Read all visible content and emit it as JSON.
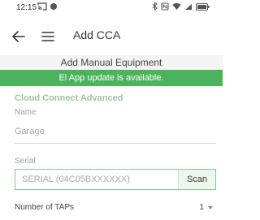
{
  "status_bar": {
    "time": "12:15",
    "left_icons": [
      "cast-icon",
      "notification-dot-icon"
    ],
    "right_icons": [
      "bluetooth-icon",
      "nfc-icon",
      "wifi-icon",
      "signal-icon",
      "battery-icon"
    ]
  },
  "app_bar": {
    "title": "Add CCA",
    "back_icon": "back-arrow-icon",
    "menu_icon": "hamburger-menu-icon"
  },
  "section_header": "Add Manual Equipment",
  "update_banner": "El App update is available.",
  "form": {
    "group_title": "Cloud Connect Advanced",
    "name_label": "Name",
    "name_placeholder": "Garage",
    "name_value": "",
    "serial_label": "Serial",
    "serial_placeholder": "SERIAL (04C05BXXXXXX)",
    "serial_value": "",
    "scan_label": "Scan",
    "taps_label": "Number of TAPs",
    "taps_value": "1"
  },
  "colors": {
    "banner": "#4bb35c",
    "group_title": "#9ac7a2",
    "serial_border": "#7fc98b"
  }
}
